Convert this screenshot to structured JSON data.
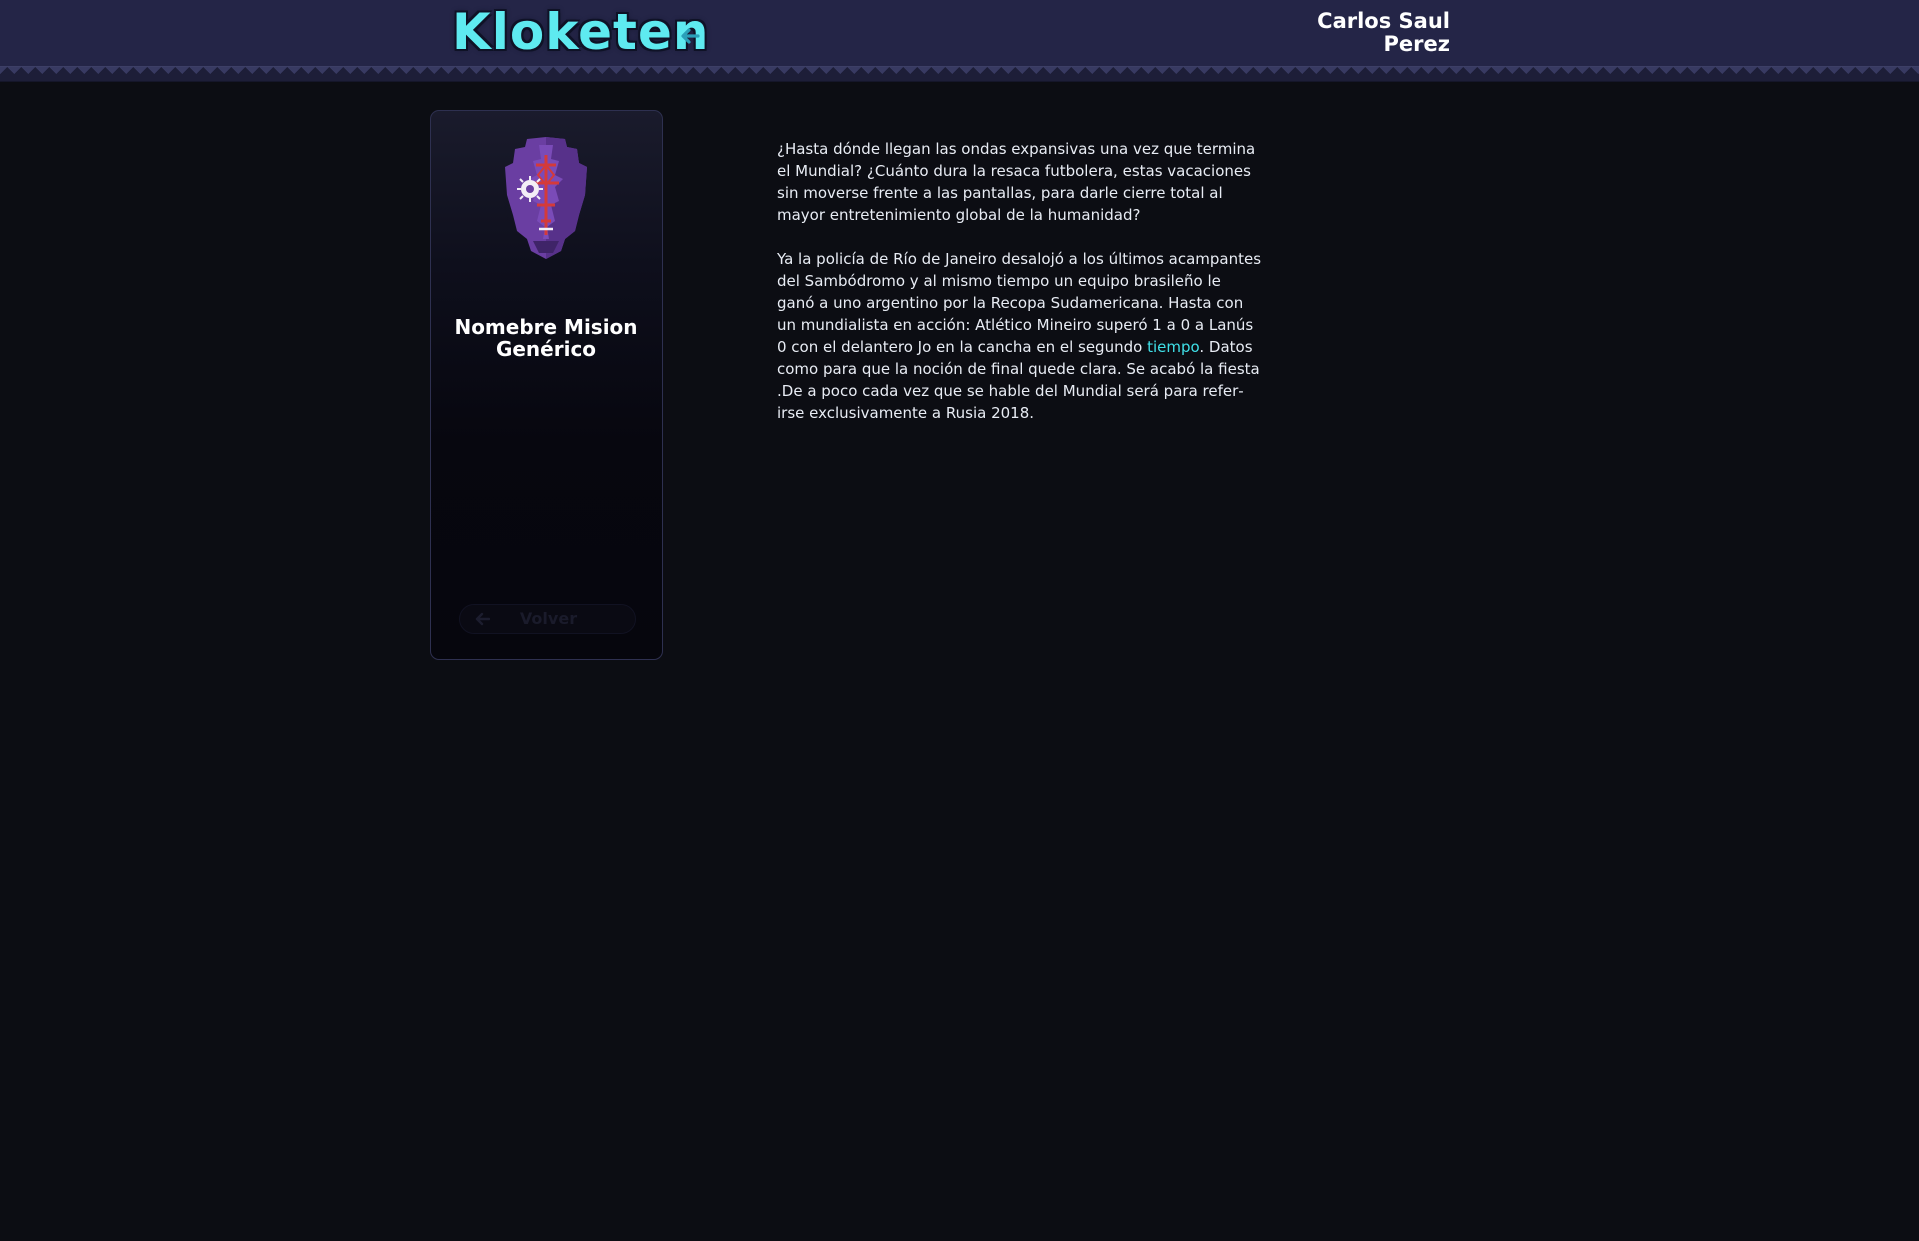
{
  "header": {
    "logo_text": "Kloketen",
    "back_icon": "arrow-left-icon",
    "user_name_line1": "Carlos Saul",
    "user_name_line2": "Perez"
  },
  "colors": {
    "topbar": "#242547",
    "background": "#0c0d13",
    "accent": "#5eeaf0",
    "link": "#3fe0e8",
    "text": "#e8ecf4"
  },
  "card": {
    "image_icon": "tribal-mask-icon",
    "title_line1": "Nomebre Mision",
    "title_line2": "Genérico",
    "back_button_label": "Volver",
    "back_button_icon": "arrow-left-icon"
  },
  "article": {
    "paragraph1": "¿Hasta dónde llegan las ondas expansivas una vez que termina el Mundial? ¿Cuánto dura la resaca futbolera, estas vacaciones sin moverse frente a las pantallas, para darle cierre total al mayor entretenimiento global de la humanidad?",
    "paragraph2_before_link": "Ya la policía de Río de Janeiro desalojó a los últimos acam­pantes del Sambódromo y al mismo tiempo un equipo brasileño le ganó a uno argentino por la Recopa Sudamericana. Hasta con un mundialista en acción: Atlético Mineiro superó 1 a 0 a Lanús 0 con el delantero Jo en la cancha en el segundo ",
    "paragraph2_link": "tiempo",
    "paragraph2_after_link": ". Datos como para que la noción de final quede clara. Se acabó la fiesta .De a poco cada vez que se hable del Mundial será para refer­irse exclusivamente a Rusia 2018."
  }
}
